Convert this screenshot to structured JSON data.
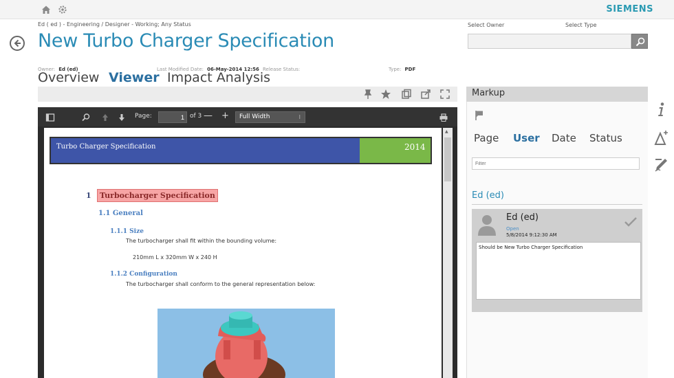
{
  "header": {
    "brand": "SIEMENS",
    "user_line": "Ed ( ed ) - Engineering / Designer - Working; Any Status",
    "title": "New Turbo Charger Specification"
  },
  "meta": {
    "owner_label": "Owner:",
    "owner_value": "Ed (ed)",
    "modified_label": "Last Modified Date:",
    "modified_value": "06-May-2014 12:56",
    "release_label": "Release Status:",
    "type_label": "Type:",
    "type_value": "PDF"
  },
  "tabs": [
    {
      "label": "Overview"
    },
    {
      "label": "Viewer"
    },
    {
      "label": "Impact Analysis"
    }
  ],
  "select": {
    "owner_label": "Select Owner",
    "type_label": "Select Type"
  },
  "pdf_toolbar": {
    "page_label": "Page:",
    "page_value": "1",
    "page_of": "of 3",
    "zoom_minus": "—",
    "zoom_plus": "+",
    "zoom_value": "Full Width"
  },
  "document": {
    "banner_title": "Turbo Charger Specification",
    "banner_year": "2014",
    "h1_num": "1",
    "h1_text": "Turbocharger Specification",
    "h11": "1.1 General",
    "h111": "1.1.1 Size",
    "p1": "The turbocharger shall fit within the bounding volume:",
    "p2": "210mm L x 320mm W x 240 H",
    "h112": "1.1.2 Configuration",
    "p3": "The turbocharger shall conform to the general representation below:"
  },
  "markup": {
    "title": "Markup",
    "sort_tabs": [
      {
        "label": "Page"
      },
      {
        "label": "User"
      },
      {
        "label": "Date"
      },
      {
        "label": "Status"
      }
    ],
    "filter_placeholder": "Filter",
    "group": "Ed (ed)",
    "comment": {
      "author": "Ed (ed)",
      "status": "Open",
      "date": "5/8/2014 9:12:30 AM",
      "body": "Should be New Turbo Charger Specification"
    }
  },
  "colors": {
    "brand": "#2a9ab2",
    "title": "#2a8bb5",
    "active_tab": "#2b6fa0",
    "banner_blue": "#3e55a8",
    "banner_green": "#7ab848",
    "highlight": "#f7a5a5"
  },
  "icons": [
    "home-icon",
    "gear-icon",
    "back-icon",
    "search-icon",
    "pin-icon",
    "star-icon",
    "copy-icon",
    "share-icon",
    "fullscreen-icon",
    "sidebar-toggle-icon",
    "find-icon",
    "prev-page-icon",
    "next-page-icon",
    "print-icon",
    "flag-icon",
    "avatar-icon",
    "check-icon",
    "info-icon",
    "annotate-icon",
    "sign-icon"
  ]
}
